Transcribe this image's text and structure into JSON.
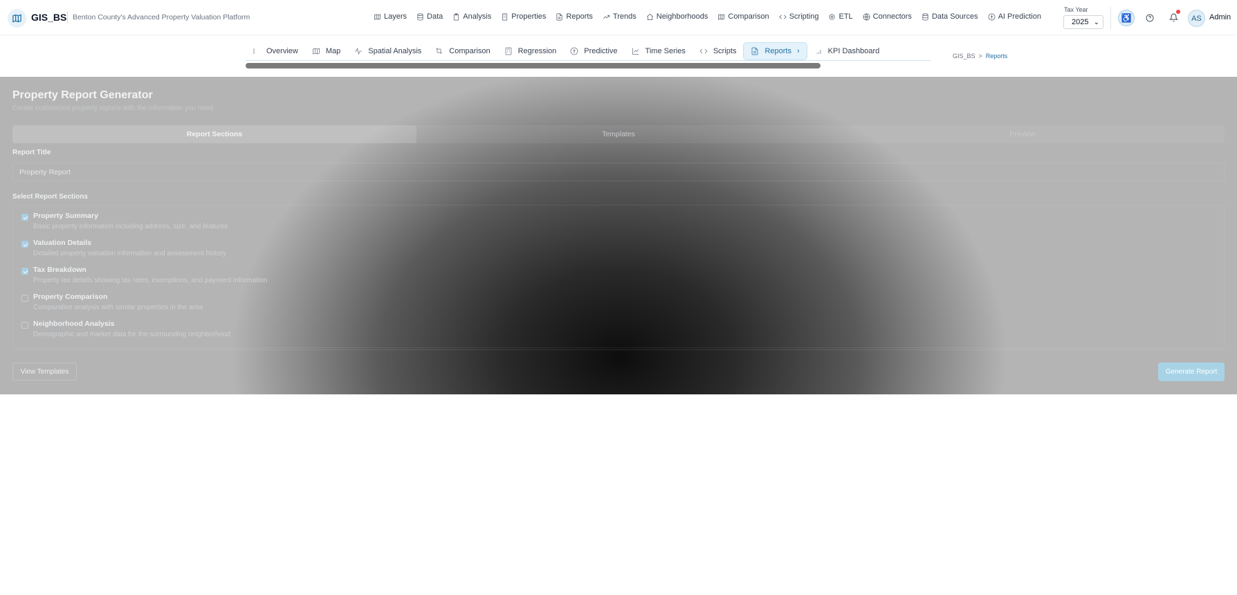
{
  "app": {
    "name": "GIS_BS",
    "tagline": "Benton County's Advanced Property Valuation Platform"
  },
  "topnav": [
    {
      "label": "Layers",
      "icon": "map-icon"
    },
    {
      "label": "Data",
      "icon": "database-icon"
    },
    {
      "label": "Analysis",
      "icon": "clipboard-icon"
    },
    {
      "label": "Properties",
      "icon": "building-icon"
    },
    {
      "label": "Reports",
      "icon": "file-text-icon"
    },
    {
      "label": "Trends",
      "icon": "trending-up-icon"
    },
    {
      "label": "Neighborhoods",
      "icon": "home-icon"
    },
    {
      "label": "Comparison",
      "icon": "map-icon"
    },
    {
      "label": "Scripting",
      "icon": "code-icon"
    },
    {
      "label": "ETL",
      "icon": "gear-icon"
    },
    {
      "label": "Connectors",
      "icon": "globe-icon"
    },
    {
      "label": "Data Sources",
      "icon": "database-icon"
    },
    {
      "label": "AI Prediction",
      "icon": "brain-icon"
    }
  ],
  "tax_year": {
    "label": "Tax Year",
    "value": "2025"
  },
  "user": {
    "initials": "AS",
    "name": "Admin"
  },
  "subnav": [
    {
      "label": "Overview",
      "icon": "layout-icon",
      "active": false
    },
    {
      "label": "Map",
      "icon": "map-icon",
      "active": false
    },
    {
      "label": "Spatial Analysis",
      "icon": "activity-icon",
      "active": false
    },
    {
      "label": "Comparison",
      "icon": "crop-icon",
      "active": false
    },
    {
      "label": "Regression",
      "icon": "calculator-icon",
      "active": false
    },
    {
      "label": "Predictive",
      "icon": "brain-icon",
      "active": false
    },
    {
      "label": "Time Series",
      "icon": "line-chart-icon",
      "active": false
    },
    {
      "label": "Scripts",
      "icon": "code-icon",
      "active": false
    },
    {
      "label": "Reports",
      "icon": "file-text-icon",
      "active": true
    },
    {
      "label": "KPI Dashboard",
      "icon": "bar-chart-icon",
      "active": false
    }
  ],
  "breadcrumb": {
    "root": "GIS_BS",
    "separator": ">",
    "current": "Reports"
  },
  "report": {
    "title": "Property Report Generator",
    "subtitle": "Create customized property reports with the information you need",
    "tabs": [
      "Report Sections",
      "Templates",
      "Preview"
    ],
    "active_tab": "Report Sections",
    "report_title_label": "Report Title",
    "report_title_value": "Property Report",
    "sections_label": "Select Report Sections",
    "sections": [
      {
        "title": "Property Summary",
        "desc": "Basic property information including address, size, and features",
        "checked": true
      },
      {
        "title": "Valuation Details",
        "desc": "Detailed property valuation information and assessment history",
        "checked": true
      },
      {
        "title": "Tax Breakdown",
        "desc": "Property tax details showing tax rates, exemptions, and payment information",
        "checked": true
      },
      {
        "title": "Property Comparison",
        "desc": "Comparative analysis with similar properties in the area",
        "checked": false
      },
      {
        "title": "Neighborhood Analysis",
        "desc": "Demographic and market data for the surrounding neighborhood",
        "checked": false
      }
    ],
    "view_templates_label": "View Templates",
    "generate_label": "Generate Report"
  },
  "colors": {
    "accent": "#1f6fa3",
    "accent_light": "#e4f2fb",
    "generate_button": "#a8d3e6",
    "notification_dot": "#ef4444"
  }
}
